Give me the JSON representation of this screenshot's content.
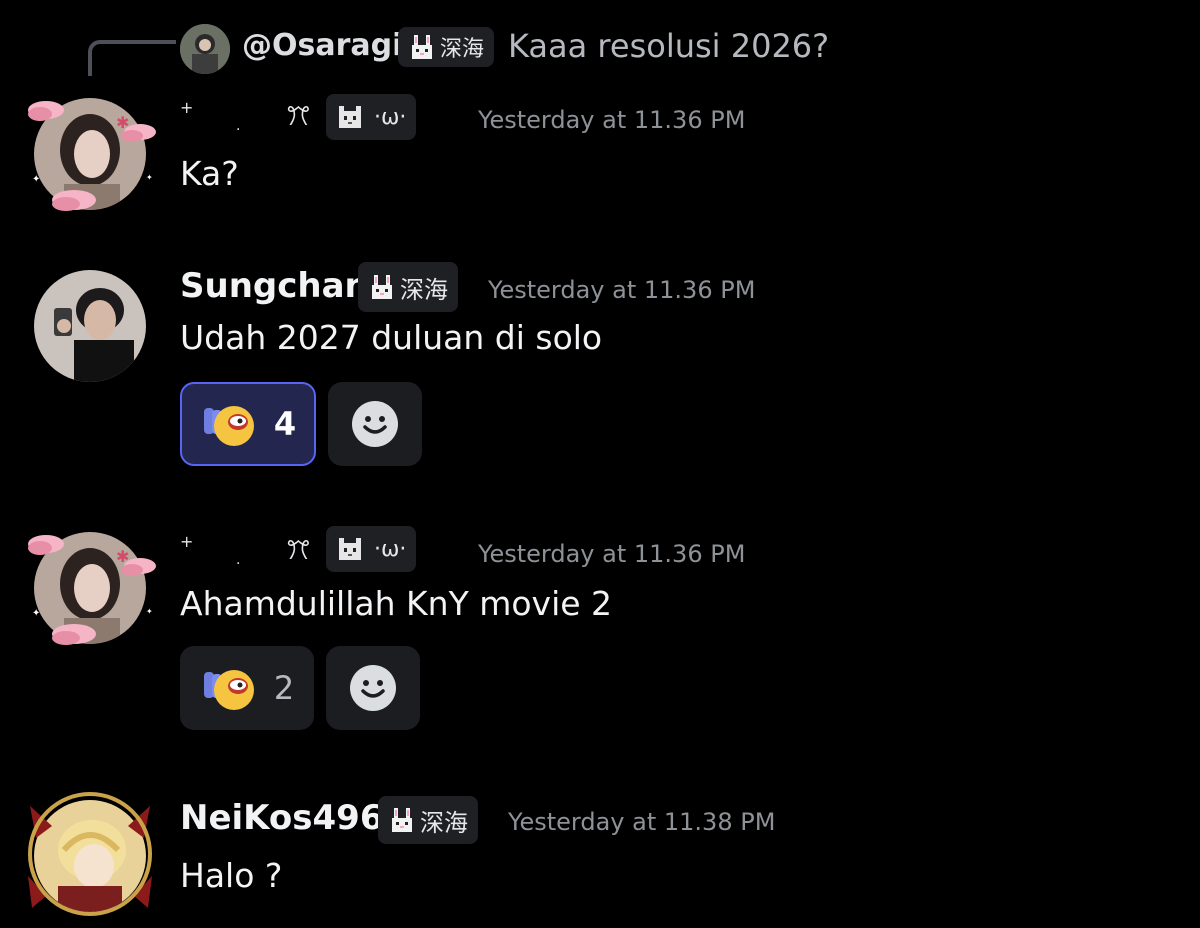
{
  "reply": {
    "author": "@Osaragi",
    "tag_text": "深海",
    "content": "Kaaa resolusi 2026?"
  },
  "messages": [
    {
      "name_glyphs": [
        "+",
        ".",
        "ꔫ"
      ],
      "tag_text": "·ω·",
      "timestamp": "Yesterday at 11.36 PM",
      "content": "Ka?"
    },
    {
      "username": "Sungchan",
      "tag_text": "深海",
      "timestamp": "Yesterday at 11.36 PM",
      "content": "Udah 2027 duluan di solo",
      "reaction_count": "4"
    },
    {
      "name_glyphs": [
        "+",
        ".",
        "ꔫ"
      ],
      "tag_text": "·ω·",
      "timestamp": "Yesterday at 11.36 PM",
      "content": "Ahamdulillah KnY movie 2",
      "reaction_count": "2"
    },
    {
      "username": "NeiKos496",
      "tag_text": "深海",
      "timestamp": "Yesterday at 11.38 PM",
      "content": "Halo ?"
    }
  ],
  "icons": {
    "bunny_tag": "bunny-icon",
    "cat_tag": "cat-icon",
    "reaction_emoji": "praying-emoji-icon",
    "add_reaction": "smile-icon"
  },
  "colors": {
    "background": "#000000",
    "tag_bg": "#1f2024",
    "timestamp": "#8e9297",
    "active_reaction_border": "#5865f2",
    "active_reaction_bg": "#23264f"
  }
}
